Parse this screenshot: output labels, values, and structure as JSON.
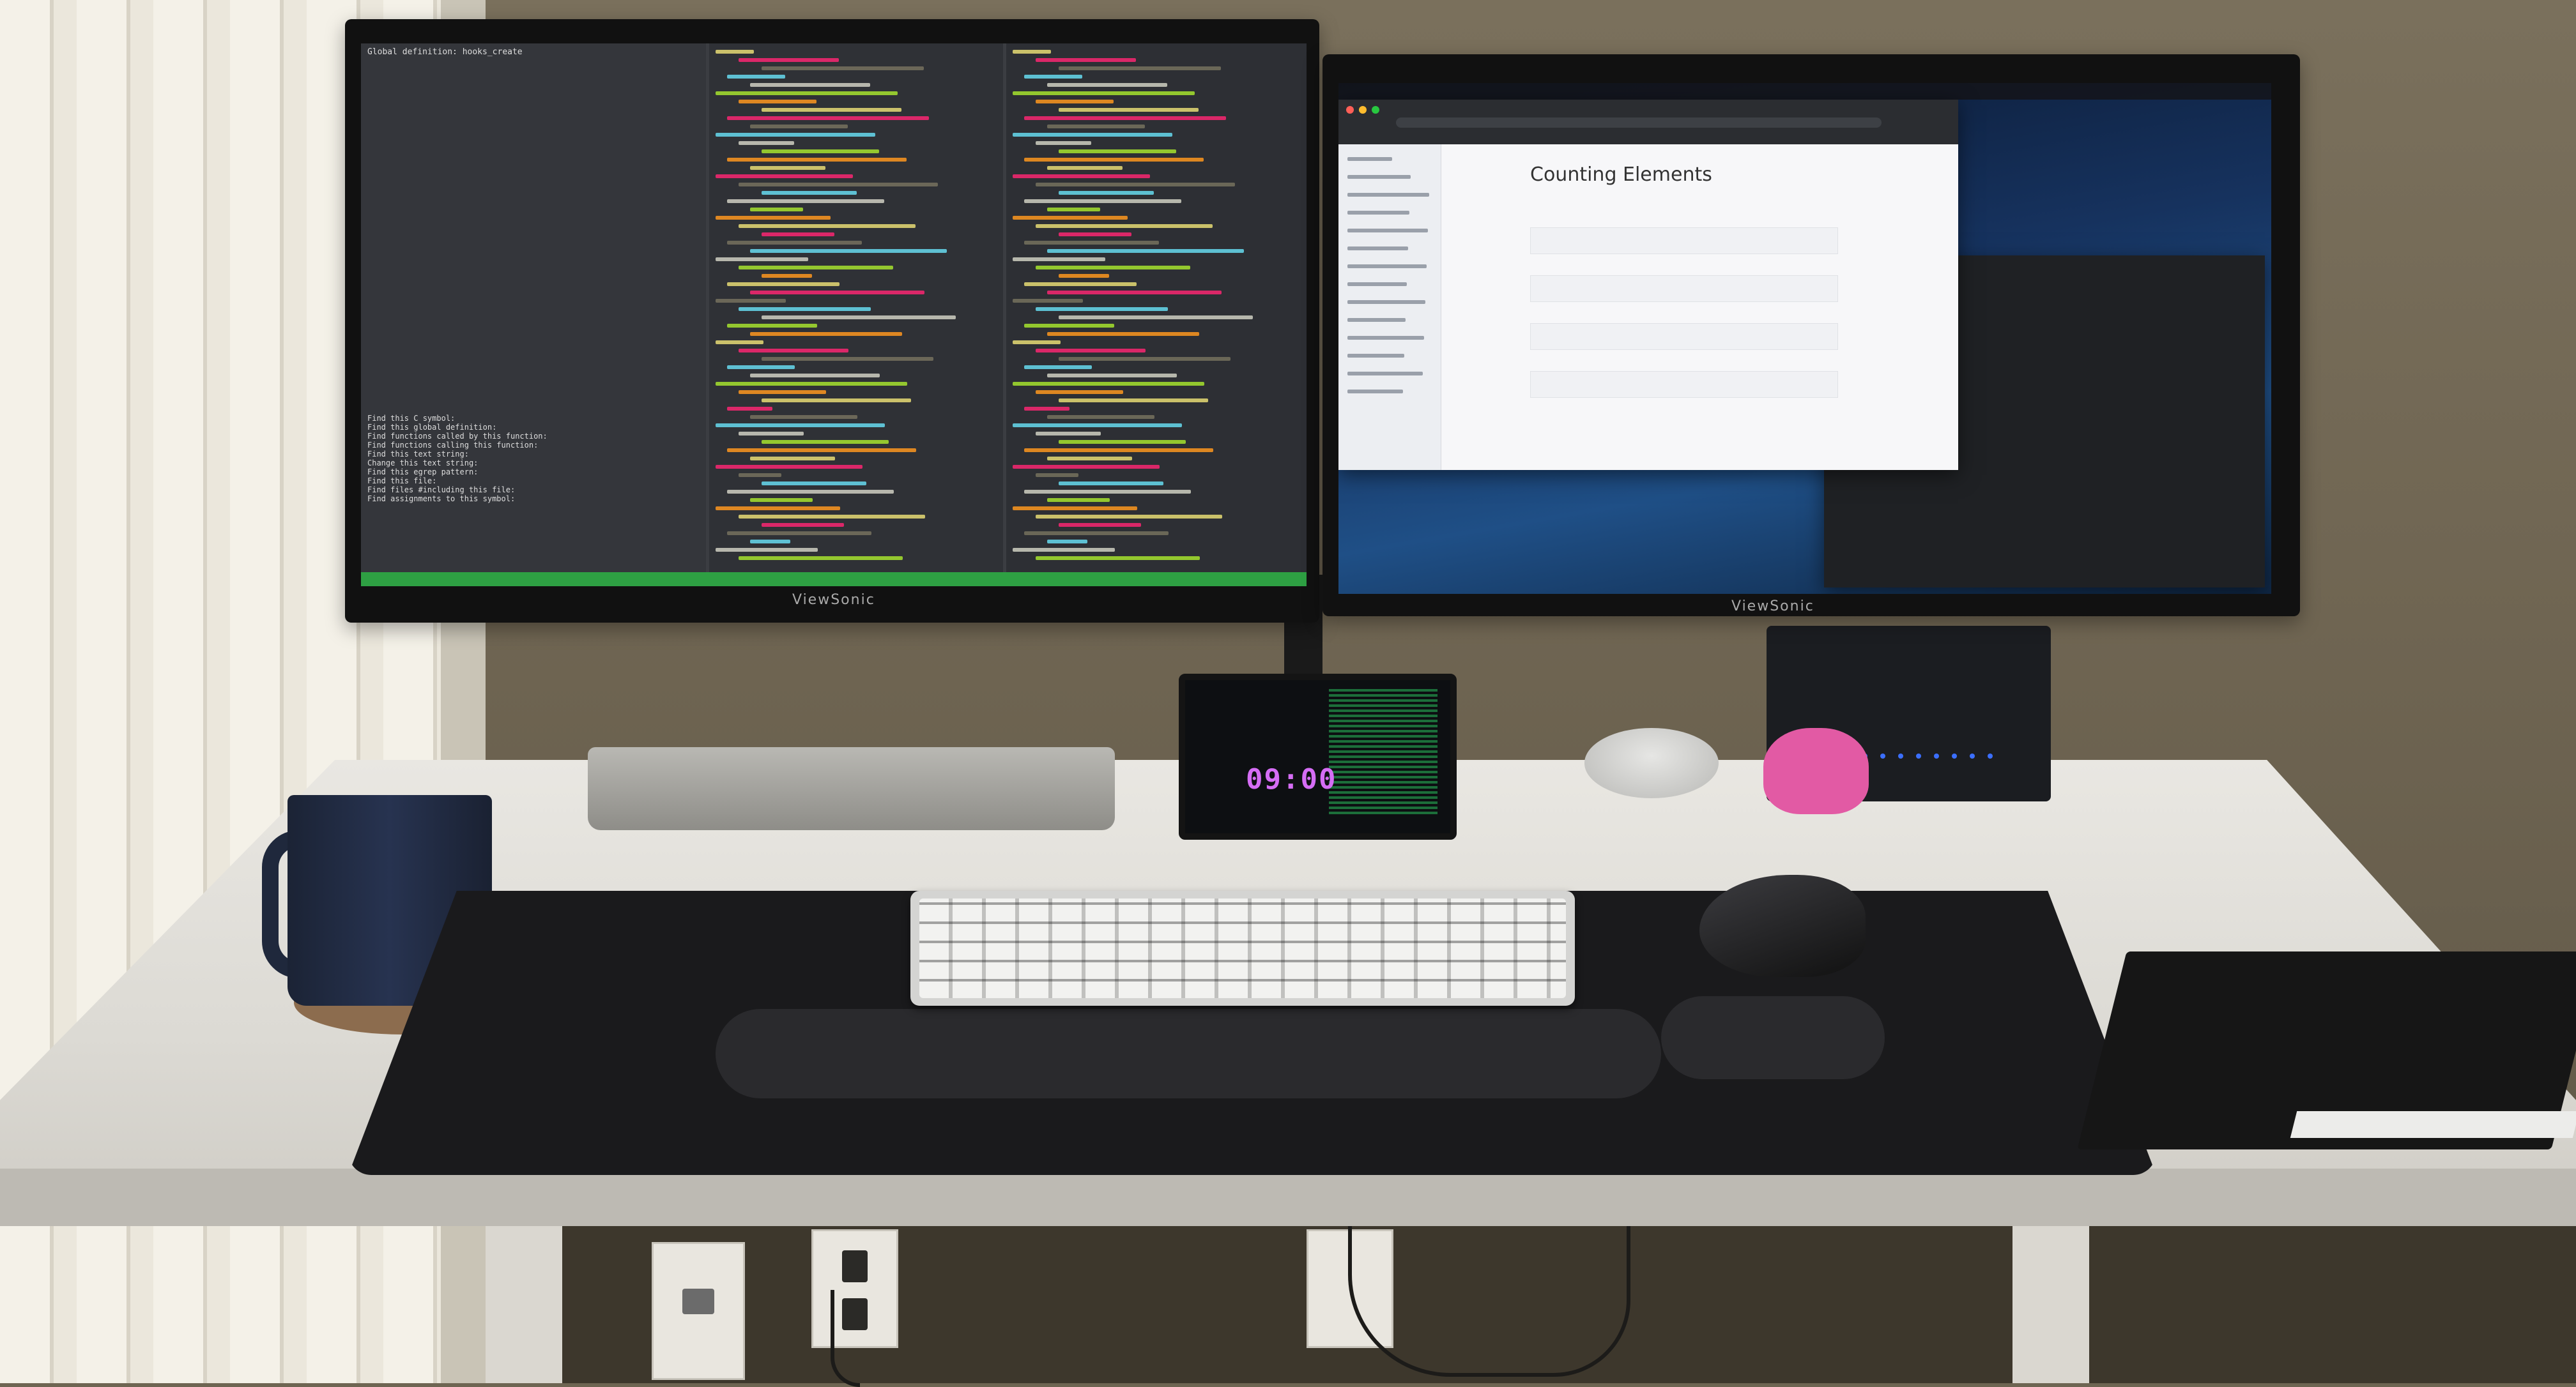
{
  "scene": "photo",
  "left_monitor": {
    "brand": "ViewSonic",
    "terminal": {
      "header": "Global definition: hooks_create",
      "menu_lines": [
        "Find this C symbol:",
        "Find this global definition:",
        "Find functions called by this function:",
        "Find functions calling this function:",
        "Find this text string:",
        "Change this text string:",
        "Find this egrep pattern:",
        "Find this file:",
        "Find files #including this file:",
        "Find assignments to this symbol:"
      ]
    }
  },
  "right_monitor": {
    "brand": "ViewSonic",
    "browser": {
      "page_title": "Counting Elements"
    }
  },
  "small_display": {
    "clock": "09:00"
  },
  "colors": {
    "wall": "#6f6552",
    "desk": "#e2e0da",
    "terminal_bg": "#34363b",
    "status_green": "#2ea043",
    "clock_magenta": "#d56df5",
    "figurine_pink": "#e25aa4"
  }
}
